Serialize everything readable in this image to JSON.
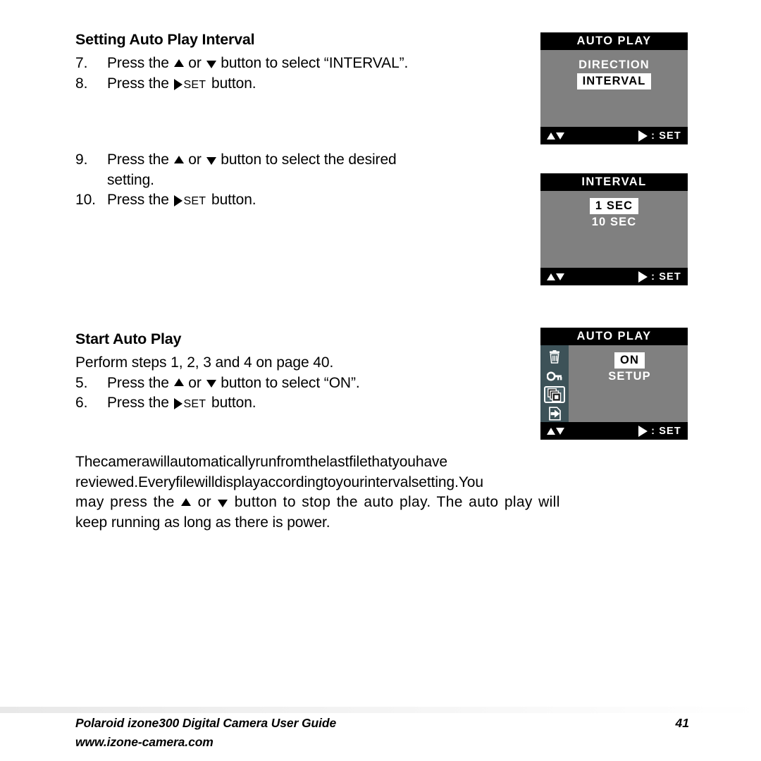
{
  "sections": {
    "interval": {
      "heading": "Setting Auto Play Interval",
      "steps": [
        {
          "num": "7.",
          "before": "Press the ",
          "mid": " or ",
          "after": " button to select “INTERVAL”."
        },
        {
          "num": "8.",
          "before": "Press the ",
          "set": "SET",
          "after": " button."
        }
      ]
    },
    "desired": {
      "steps": [
        {
          "num": "9.",
          "before": "Press the ",
          "mid": " or ",
          "after": " button to select the desired",
          "cont": "setting."
        },
        {
          "num": "10.",
          "before": "Press the ",
          "set": "SET",
          "after": " button."
        }
      ]
    },
    "start": {
      "heading": "Start Auto Play",
      "intro": "Perform steps 1, 2, 3 and 4 on page 40.",
      "steps": [
        {
          "num": "5.",
          "before": "Press the ",
          "mid": " or ",
          "after": " button to select “ON”."
        },
        {
          "num": "6.",
          "before": "Press the ",
          "set": "SET",
          "after": " button."
        }
      ]
    }
  },
  "paragraph": {
    "line1": [
      "The",
      "camera",
      "will",
      "automatically",
      "run",
      "from",
      "the",
      "last",
      "file",
      "that",
      "you",
      "have"
    ],
    "line2": [
      "reviewed.",
      "Every",
      "file",
      "will",
      "display",
      "according",
      "to",
      "your",
      "interval",
      "setting.",
      "You"
    ],
    "line3_before": "may press the ",
    "line3_mid": " or ",
    "line3_after": " button to stop the auto play. The auto play will",
    "line4": "keep running as long as there is power."
  },
  "lcd_screens": [
    {
      "id": "auto-play-interval",
      "title": "AUTO PLAY",
      "rows": [
        {
          "label": "DIRECTION",
          "selected": false
        },
        {
          "label": "INTERVAL",
          "selected": true
        }
      ],
      "footer": {
        "set_label": "SET",
        "colon": ":"
      },
      "has_icon_rail": false
    },
    {
      "id": "interval-values",
      "title": "INTERVAL",
      "rows": [
        {
          "label": "1 SEC",
          "selected": true
        },
        {
          "label": "10 SEC",
          "selected": false
        }
      ],
      "footer": {
        "set_label": "SET",
        "colon": ":"
      },
      "has_icon_rail": false
    },
    {
      "id": "auto-play-on",
      "title": "AUTO PLAY",
      "rows": [
        {
          "label": "ON",
          "selected": true
        },
        {
          "label": "SETUP",
          "selected": false
        }
      ],
      "footer": {
        "set_label": "SET",
        "colon": ":"
      },
      "has_icon_rail": true,
      "icons": [
        {
          "name": "trash-icon",
          "active": false
        },
        {
          "name": "key-icon",
          "active": false
        },
        {
          "name": "slideshow-frames-icon",
          "active": true
        },
        {
          "name": "file-transfer-icon",
          "active": false
        }
      ]
    }
  ],
  "footer": {
    "title": "Polaroid izone300 Digital Camera User Guide",
    "page_number": "41",
    "url": "www.izone-camera.com"
  },
  "colors": {
    "lcd_background": "#808080",
    "lcd_bar": "#000000",
    "icon_rail": "#3d5258",
    "highlight": "#ffffff",
    "text": "#000000"
  }
}
